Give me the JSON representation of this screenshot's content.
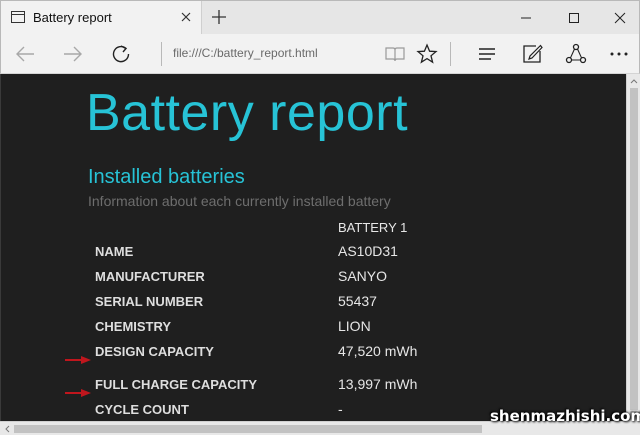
{
  "browser": {
    "tab_title": "Battery report",
    "address": "file:///C:/battery_report.html",
    "icons": {
      "page": "page-icon",
      "close_tab": "close-icon",
      "new_tab": "plus-icon",
      "minimize": "minimize-icon",
      "maximize": "maximize-icon",
      "close_window": "close-icon",
      "back": "back-arrow-icon",
      "forward": "forward-arrow-icon",
      "refresh": "refresh-icon",
      "reading_view": "book-icon",
      "favorite": "star-icon",
      "hub": "hub-lines-icon",
      "web_note": "pen-note-icon",
      "share": "share-icon",
      "more": "more-dots-icon"
    }
  },
  "report": {
    "title": "Battery report",
    "section_title": "Installed batteries",
    "section_subtitle": "Information about each currently installed battery",
    "column_header": "BATTERY 1",
    "rows": [
      {
        "label": "NAME",
        "value": "AS10D31",
        "arrow": false
      },
      {
        "label": "MANUFACTURER",
        "value": "SANYO",
        "arrow": false
      },
      {
        "label": "SERIAL NUMBER",
        "value": "55437",
        "arrow": false
      },
      {
        "label": "CHEMISTRY",
        "value": "LION",
        "arrow": false
      },
      {
        "label": "DESIGN CAPACITY",
        "value": "47,520 mWh",
        "arrow": true
      },
      {
        "label": "FULL CHARGE CAPACITY",
        "value": "13,997 mWh",
        "arrow": true
      },
      {
        "label": "CYCLE COUNT",
        "value": "-",
        "arrow": false
      }
    ]
  },
  "colors": {
    "accent": "#27c3d6",
    "background": "#1f1f1f",
    "arrow": "#c0161d"
  },
  "watermark": "shenmazhishi.com"
}
